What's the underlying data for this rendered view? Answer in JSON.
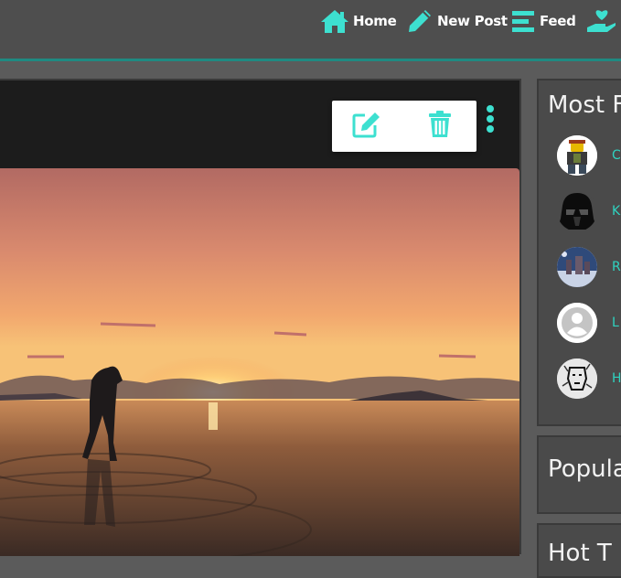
{
  "nav": {
    "home_label": "Home",
    "new_post_label": "New Post",
    "feed_label": "Feed",
    "accent_color": "#3de0d0"
  },
  "post": {
    "meta_count": "2",
    "edit_icon": "edit-icon",
    "delete_icon": "trash-icon"
  },
  "sidebar": {
    "most_followed_title": "Most F",
    "users": [
      {
        "name": "C",
        "avatar": "lego-figure"
      },
      {
        "name": "K",
        "avatar": "darth-vader"
      },
      {
        "name": "R",
        "avatar": "winter-castle"
      },
      {
        "name": "L",
        "avatar": "default-user"
      },
      {
        "name": "H",
        "avatar": "sketch-portrait"
      }
    ],
    "popular_title": "Popula",
    "third_title": "Hot T"
  }
}
